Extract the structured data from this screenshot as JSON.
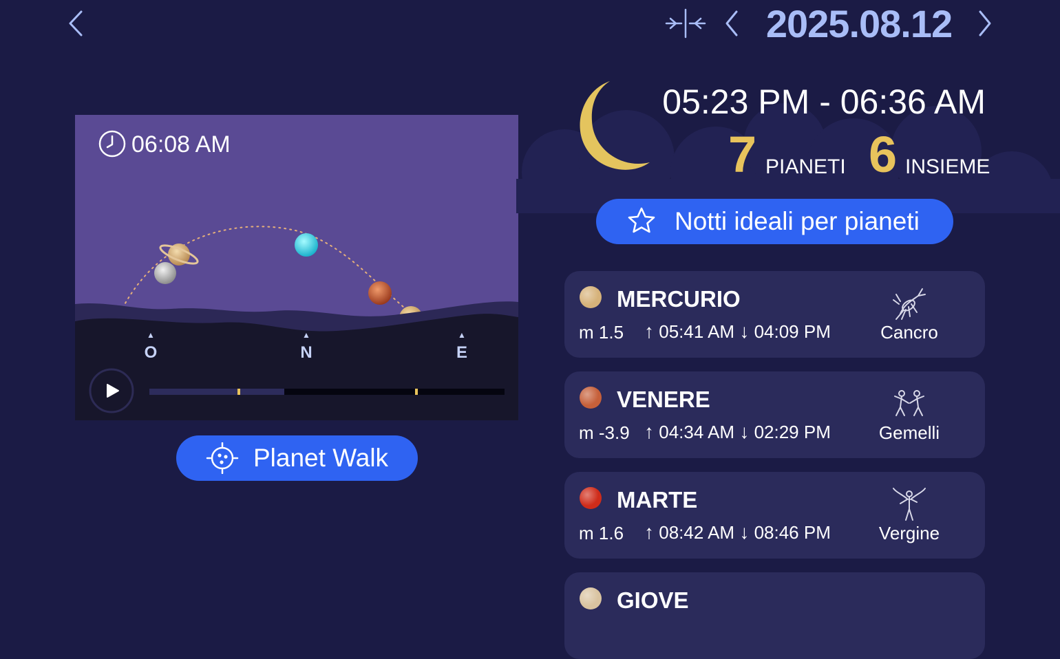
{
  "header": {
    "date": "2025.08.12",
    "colors": {
      "accent": "#a9bdf7",
      "background": "#1b1b45"
    }
  },
  "icons": {
    "back": "chevron-left-icon",
    "today": "center-arrows-icon",
    "prev": "chevron-left-icon",
    "next": "chevron-right-icon",
    "clock": "clock-icon",
    "play": "play-icon",
    "planet_walk": "target-icon",
    "ideal_nights": "star-icon",
    "moon": "crescent-moon-icon"
  },
  "sky": {
    "time": "06:08 AM",
    "directions": [
      "O",
      "N",
      "E"
    ],
    "timeline_progress": 0.38
  },
  "planet_walk": {
    "label": "Planet Walk"
  },
  "night": {
    "range": "05:23 PM - 06:36 AM",
    "planets_count": "7",
    "planets_label": "PIANETI",
    "together_count": "6",
    "together_label": "INSIEME"
  },
  "ideal_nights": {
    "label": "Notti ideali per pianeti"
  },
  "planets": [
    {
      "name": "MERCURIO",
      "magnitude": "m 1.5",
      "rise": "05:41 AM",
      "set": "04:09 PM",
      "constellation": "Cancro",
      "color": "#d6b27a",
      "zodiac_icon": "crab-icon"
    },
    {
      "name": "VENERE",
      "magnitude": "m -3.9",
      "rise": "04:34 AM",
      "set": "02:29 PM",
      "constellation": "Gemelli",
      "color": "#c6603a",
      "zodiac_icon": "twins-icon"
    },
    {
      "name": "MARTE",
      "magnitude": "m 1.6",
      "rise": "08:42 AM",
      "set": "08:46 PM",
      "constellation": "Vergine",
      "color": "#cf2c1a",
      "zodiac_icon": "maiden-icon"
    },
    {
      "name": "GIOVE",
      "color": "#d9c3a0"
    }
  ]
}
